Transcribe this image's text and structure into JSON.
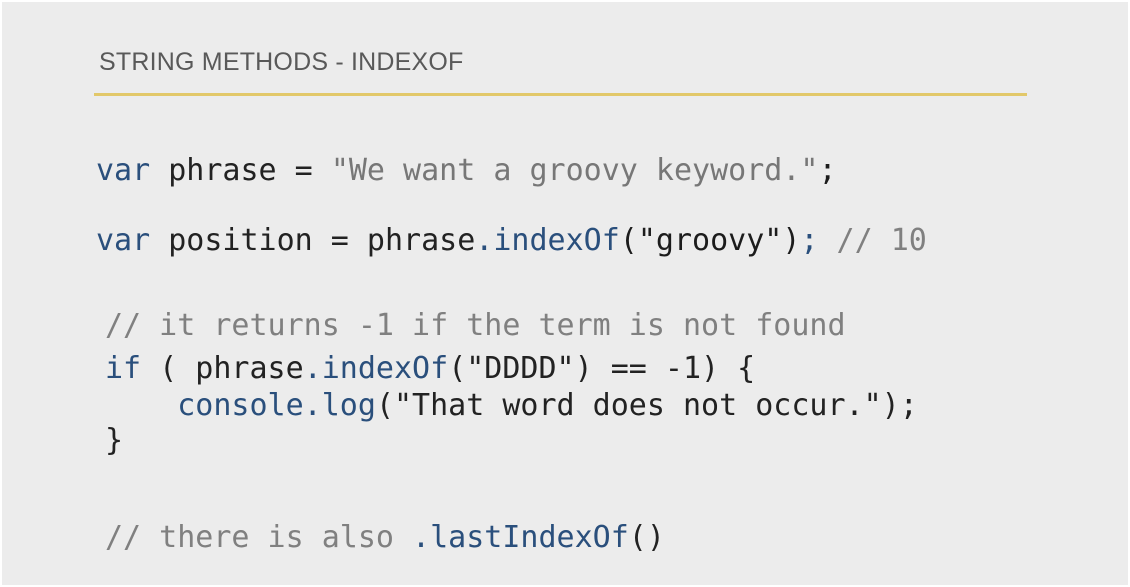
{
  "slide": {
    "title": "STRING METHODS - INDEXOF",
    "colors": {
      "background": "#ececec",
      "rule": "#e2c86a",
      "keyword": "#2a4f7c",
      "comment": "#808080"
    }
  },
  "code": {
    "line1": {
      "kw": "var",
      "ident": " phrase = ",
      "string": "\"We want a groovy keyword.\"",
      "end": ";"
    },
    "line2": {
      "kw": "var",
      "ident": " position = phrase",
      "method": ".indexOf",
      "args": "(\"groovy\")",
      "semi": ";",
      "comment": " // 10"
    },
    "line3": {
      "comment": "// it returns -1 if the term is not found"
    },
    "line4": {
      "kw": "if",
      "pre": " ( phrase",
      "method": ".indexOf",
      "rest": "(\"DDDD\") == -1) {"
    },
    "line5": {
      "indent": "    ",
      "method": "console.log",
      "rest": "(\"That word does not occur.\");"
    },
    "line6": {
      "text": "}"
    },
    "line7": {
      "comment": "// there is also ",
      "method": ".lastIndexOf",
      "rest": "()"
    }
  }
}
